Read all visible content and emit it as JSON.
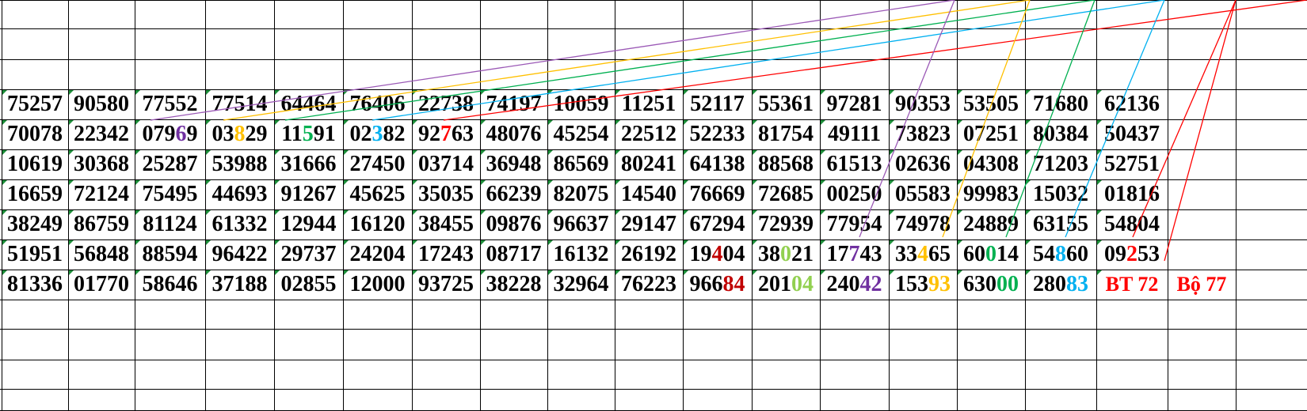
{
  "grid": {
    "rows": [
      [
        "75257",
        "90580",
        "77552",
        "77514",
        "64464",
        "76406",
        "22738",
        "74197",
        "10059",
        "11251",
        "52117",
        "55361",
        "97281",
        "90353",
        "53505",
        "71680",
        "62136",
        "",
        ""
      ],
      [
        "70078",
        "22342",
        "07969",
        "03829",
        "11591",
        "02382",
        "92763",
        "48076",
        "45254",
        "22512",
        "52233",
        "81754",
        "49111",
        "73823",
        "07251",
        "80384",
        "50437",
        "",
        ""
      ],
      [
        "10619",
        "30368",
        "25287",
        "53988",
        "31666",
        "27450",
        "03714",
        "36948",
        "86569",
        "80241",
        "64138",
        "88568",
        "61513",
        "02636",
        "04308",
        "71203",
        "52751",
        "",
        ""
      ],
      [
        "16659",
        "72124",
        "75495",
        "44693",
        "91267",
        "45625",
        "35035",
        "66239",
        "82075",
        "14540",
        "76669",
        "72685",
        "00250",
        "05583",
        "99983",
        "15032",
        "01816",
        "",
        ""
      ],
      [
        "38249",
        "86759",
        "81124",
        "61332",
        "12944",
        "16120",
        "38455",
        "09876",
        "96637",
        "29147",
        "67294",
        "72939",
        "77954",
        "74978",
        "24889",
        "63155",
        "54804",
        "",
        ""
      ],
      [
        "51951",
        "56848",
        "88594",
        "96422",
        "29737",
        "24204",
        "17243",
        "08717",
        "16132",
        "26192",
        "19404",
        "38021",
        "17743",
        "33465",
        "60014",
        "54860",
        "09253",
        "",
        ""
      ],
      [
        "81336",
        "01770",
        "58646",
        "37188",
        "02855",
        "12000",
        "93725",
        "38228",
        "32964",
        "76223",
        "96684",
        "20104",
        "24042",
        "15393",
        "63000",
        "28083",
        "BT 72",
        "Bộ 77",
        ""
      ]
    ],
    "highlights": [
      {
        "row": 1,
        "col": 2,
        "digit": 3,
        "color": "#7030a0"
      },
      {
        "row": 1,
        "col": 3,
        "digit": 2,
        "color": "#ffc000"
      },
      {
        "row": 1,
        "col": 4,
        "digit": 2,
        "color": "#00b050"
      },
      {
        "row": 1,
        "col": 5,
        "digit": 2,
        "color": "#00b0f0"
      },
      {
        "row": 1,
        "col": 6,
        "digit": 2,
        "color": "#ff0000"
      },
      {
        "row": 5,
        "col": 10,
        "digit": 2,
        "color": "#c00000"
      },
      {
        "row": 5,
        "col": 11,
        "digit": 2,
        "color": "#92d050"
      },
      {
        "row": 5,
        "col": 12,
        "digit": 2,
        "color": "#7030a0"
      },
      {
        "row": 5,
        "col": 13,
        "digit": 2,
        "color": "#ffc000"
      },
      {
        "row": 5,
        "col": 14,
        "digit": 2,
        "color": "#00b050"
      },
      {
        "row": 5,
        "col": 15,
        "digit": 2,
        "color": "#00b0f0"
      },
      {
        "row": 5,
        "col": 16,
        "digit": 2,
        "color": "#ff0000"
      },
      {
        "row": 6,
        "col": 10,
        "digit": 3,
        "color": "#c00000",
        "len": 2
      },
      {
        "row": 6,
        "col": 10,
        "digit": 4,
        "color": "#c00000"
      },
      {
        "row": 6,
        "col": 11,
        "digit": 3,
        "color": "#92d050"
      },
      {
        "row": 6,
        "col": 11,
        "digit": 4,
        "color": "#92d050"
      },
      {
        "row": 6,
        "col": 12,
        "digit": 3,
        "color": "#7030a0"
      },
      {
        "row": 6,
        "col": 12,
        "digit": 4,
        "color": "#7030a0"
      },
      {
        "row": 6,
        "col": 13,
        "digit": 3,
        "color": "#ffc000"
      },
      {
        "row": 6,
        "col": 13,
        "digit": 4,
        "color": "#ffc000"
      },
      {
        "row": 6,
        "col": 14,
        "digit": 3,
        "color": "#00b050"
      },
      {
        "row": 6,
        "col": 14,
        "digit": 4,
        "color": "#00b050"
      },
      {
        "row": 6,
        "col": 15,
        "digit": 3,
        "color": "#00b0f0"
      },
      {
        "row": 6,
        "col": 15,
        "digit": 4,
        "color": "#00b0f0"
      }
    ],
    "red_text_cells": [
      {
        "row": 6,
        "col": 16,
        "color": "#ff0000"
      },
      {
        "row": 6,
        "col": 17,
        "color": "#ff0000"
      }
    ]
  },
  "line_colors": {
    "purple": "#9b59b6",
    "yellow": "#ffc000",
    "green": "#00b050",
    "blue": "#00b0f0",
    "red": "#ff0000"
  }
}
